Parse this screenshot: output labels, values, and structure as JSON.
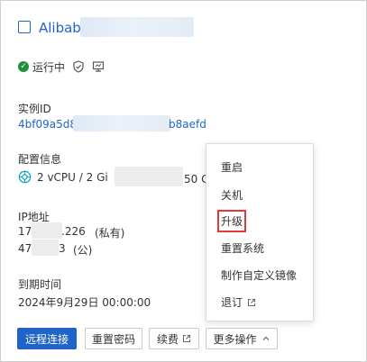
{
  "instance": {
    "name_visible": "Alibab",
    "status": "运行中",
    "id_label": "实例ID",
    "id_prefix_visible": "4bf09a5d8",
    "id_suffix_visible": "b8aefd",
    "spec_label": "配置信息",
    "spec_prefix_visible": "2 vCPU / 2 Gi",
    "spec_suffix_visible": "50 G",
    "ip_label": "IP地址",
    "ip_private_prefix": "17",
    "ip_private_suffix": ".226",
    "ip_private_tag": "(私有)",
    "ip_public_prefix": "47",
    "ip_public_suffix": "3",
    "ip_public_tag": "(公)",
    "expire_label": "到期时间",
    "expire_value": "2024年9月29日 00:00:00"
  },
  "menu": {
    "items": [
      "重启",
      "关机",
      "升级",
      "重置系统",
      "制作自定义镜像",
      "退订"
    ],
    "highlighted": "升级"
  },
  "buttons": {
    "remote": "远程连接",
    "reset_pwd": "重置密码",
    "renew": "续费",
    "more": "更多操作"
  },
  "colors": {
    "accent": "#1f64c9",
    "status_ok": "#1e8f3c",
    "highlight": "#e23a3a"
  },
  "icons": {
    "status": "check-circle-icon",
    "security": "shield-check-icon",
    "monitor": "monitor-icon",
    "chip": "chip-icon",
    "external": "external-link-icon",
    "chevron": "chevron-up-icon"
  }
}
